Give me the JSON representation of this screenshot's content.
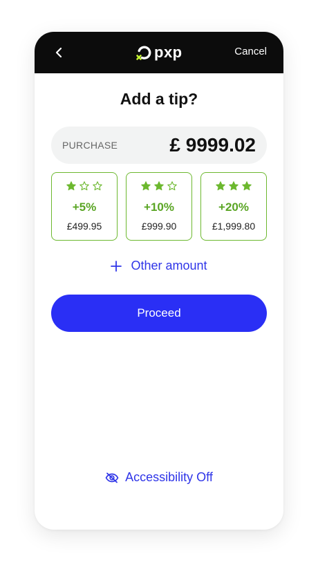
{
  "header": {
    "logo_text": "pxp",
    "cancel_label": "Cancel"
  },
  "title": "Add a tip?",
  "purchase": {
    "label": "PURCHASE",
    "amount": "£ 9999.02"
  },
  "tips": [
    {
      "stars_filled": 1,
      "stars_total": 3,
      "percent": "+5%",
      "amount": "£499.95"
    },
    {
      "stars_filled": 2,
      "stars_total": 3,
      "percent": "+10%",
      "amount": "£999.90"
    },
    {
      "stars_filled": 3,
      "stars_total": 3,
      "percent": "+20%",
      "amount": "£1,999.80"
    }
  ],
  "other_amount_label": "Other amount",
  "proceed_label": "Proceed",
  "accessibility_label": "Accessibility Off",
  "colors": {
    "header_bg": "#0c0c0c",
    "accent_green": "#6cb82e",
    "accent_blue": "#2a2ff5",
    "logo_mark": "#c6f432"
  }
}
